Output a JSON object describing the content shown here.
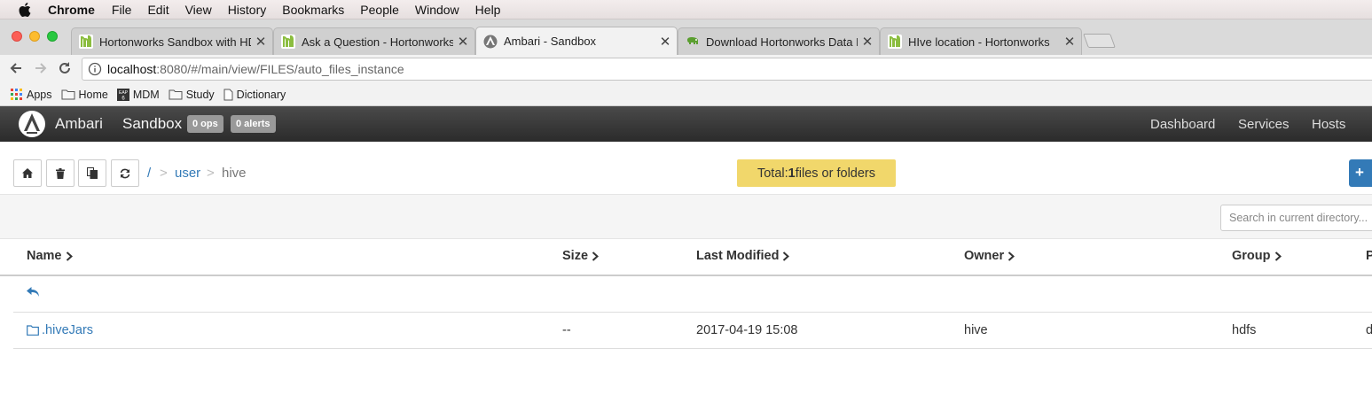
{
  "menubar": {
    "app_name": "Chrome",
    "items": [
      "File",
      "Edit",
      "View",
      "History",
      "Bookmarks",
      "People",
      "Window",
      "Help"
    ]
  },
  "tabs": [
    {
      "title": "Hortonworks Sandbox with HDP",
      "icon": "hortonworks-leaf-icon",
      "active": false
    },
    {
      "title": "Ask a Question - Hortonworks",
      "icon": "hortonworks-leaf-icon",
      "active": false
    },
    {
      "title": "Ambari - Sandbox",
      "icon": "ambari-icon",
      "active": true
    },
    {
      "title": "Download Hortonworks Data Platform",
      "icon": "hadoop-elephant-icon",
      "active": false
    },
    {
      "title": "HIve location - Hortonworks",
      "icon": "hortonworks-leaf-icon",
      "active": false
    }
  ],
  "address_bar": {
    "host": "localhost",
    "path": ":8080/#/main/view/FILES/auto_files_instance"
  },
  "bookmarks": [
    {
      "label": "Apps",
      "icon": "apps-grid-icon"
    },
    {
      "label": "Home",
      "icon": "folder-icon"
    },
    {
      "label": "MDM",
      "icon": "sap-icon"
    },
    {
      "label": "Study",
      "icon": "folder-icon"
    },
    {
      "label": "Dictionary",
      "icon": "page-icon"
    }
  ],
  "ambari": {
    "title": "Ambari",
    "cluster": "Sandbox",
    "ops_badge": "0 ops",
    "alerts_badge": "0 alerts",
    "nav": [
      "Dashboard",
      "Services",
      "Hosts"
    ]
  },
  "files": {
    "breadcrumb": {
      "root": "/",
      "separator": ">",
      "segments": [
        "user",
        "hive"
      ]
    },
    "total": {
      "prefix": "Total: ",
      "count": "1",
      "suffix": " files or folders"
    },
    "new_button_label": "+",
    "search_placeholder": "Search in current directory...",
    "columns": [
      "Name",
      "Size",
      "Last Modified",
      "Owner",
      "Group",
      "P"
    ],
    "rows": [
      {
        "name": ".hiveJars",
        "size": "--",
        "modified": "2017-04-19 15:08",
        "owner": "hive",
        "group": "hdfs",
        "perm": "d"
      }
    ]
  },
  "colors": {
    "link": "#337ab7",
    "total_badge": "#f1d76b",
    "ambari_bar": "#333333"
  }
}
